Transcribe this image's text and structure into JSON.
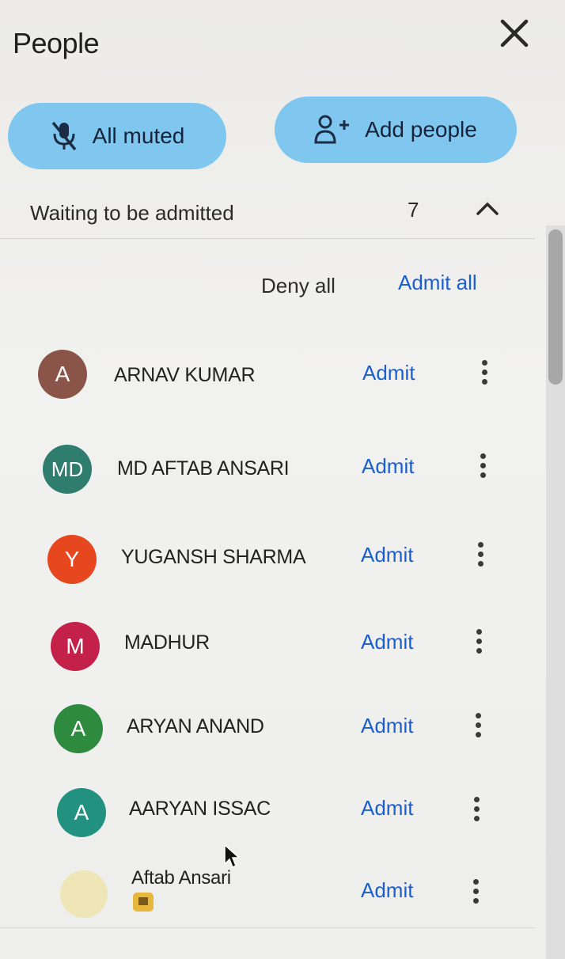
{
  "header": {
    "title": "People"
  },
  "actions": {
    "mute_all_label": "All muted",
    "add_people_label": "Add people"
  },
  "waiting": {
    "label": "Waiting to be admitted",
    "count": "7",
    "deny_all_label": "Deny all",
    "admit_all_label": "Admit all",
    "admit_label": "Admit",
    "people": [
      {
        "initials": "A",
        "name": "ARNAV KUMAR",
        "avatar_color": "#8a5548"
      },
      {
        "initials": "MD",
        "name": "MD AFTAB ANSARI",
        "avatar_color": "#2f7d6f"
      },
      {
        "initials": "Y",
        "name": "YUGANSH SHARMA",
        "avatar_color": "#e6471f"
      },
      {
        "initials": "M",
        "name": "MADHUR",
        "avatar_color": "#c4214a"
      },
      {
        "initials": "A",
        "name": "ARYAN ANAND",
        "avatar_color": "#2e8a3e"
      },
      {
        "initials": "A",
        "name": "AARYAN ISSAC",
        "avatar_color": "#23917f"
      },
      {
        "initials": "",
        "name": "Aftab Ansari",
        "avatar_color": "#efe6b8"
      }
    ]
  },
  "icons": {
    "close": "close-icon",
    "mic_off": "mic-off-icon",
    "add_person": "person-add-icon",
    "collapse": "chevron-up-icon",
    "more": "more-vert-icon"
  },
  "colors": {
    "accent": "#1a5fd0",
    "pill": "#7fc7ee"
  }
}
